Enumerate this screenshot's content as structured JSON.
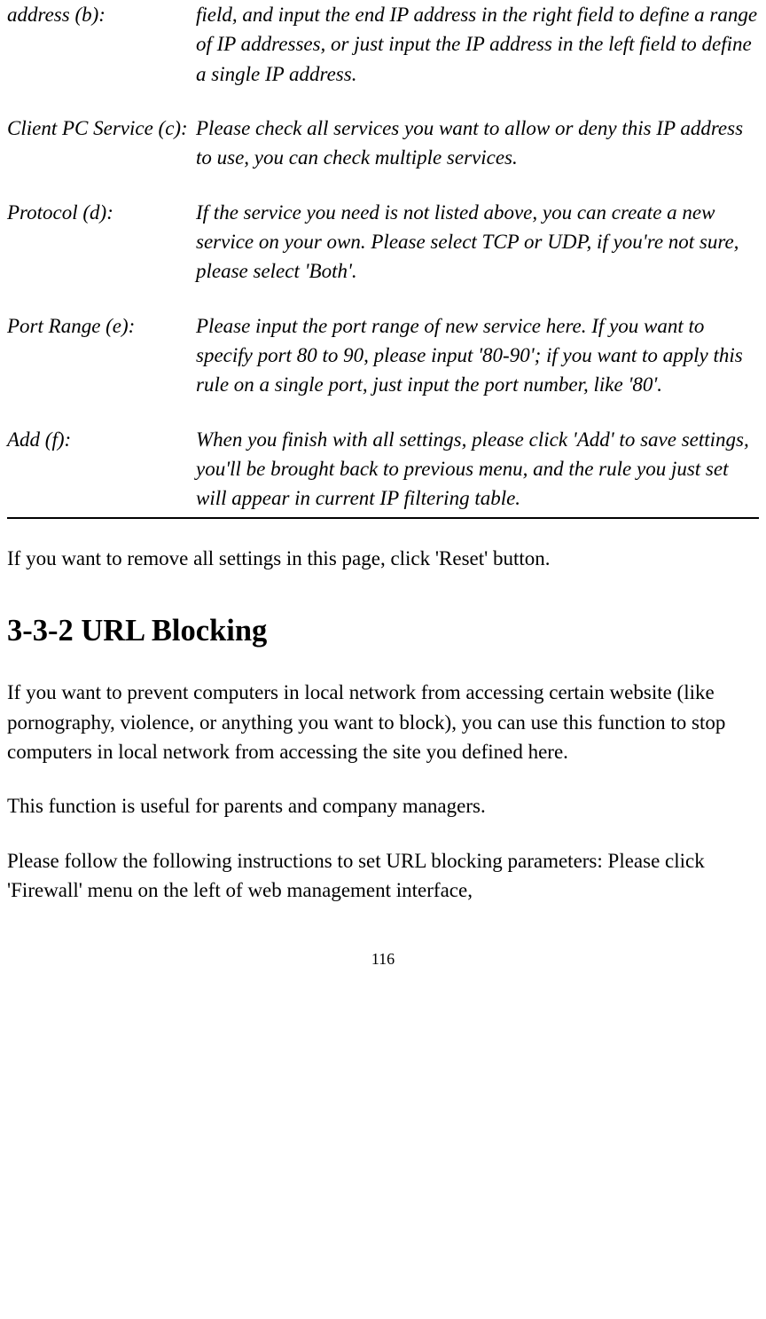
{
  "definitions": [
    {
      "term": "address (b):",
      "desc": "field, and input the end IP address in the right field to define a range of IP addresses, or just input the IP address in the left field to define a single IP address."
    },
    {
      "term": "Client PC Service (c):",
      "desc": "Please check all services you want to allow or deny this IP address to use, you can check multiple services."
    },
    {
      "term": "Protocol (d):",
      "desc": "If the service you need is not listed above, you can create a new service on your own. Please select TCP or UDP, if you're not sure, please select 'Both'."
    },
    {
      "term": "Port Range (e):",
      "desc": "Please input the port range of new service here. If you want to specify port 80 to 90, please input '80-90'; if you want to apply this rule on a single port, just input the port number, like '80'."
    },
    {
      "term": "Add (f):",
      "desc": "When you finish with all settings, please click 'Add' to save settings, you'll be brought back to previous menu, and the rule you just set will appear in current IP filtering table."
    }
  ],
  "para_reset": "If you want to remove all settings in this page, click 'Reset' button.",
  "section_heading": "3-3-2 URL Blocking",
  "para_url_blocking": "If you want to prevent computers in local network from accessing certain website (like pornography, violence, or anything you want to block), you can use this function to stop computers in local network from accessing the site you defined here.",
  "para_useful": "This function is useful for parents and company managers.",
  "para_instructions": "Please follow the following instructions to set URL blocking parameters: Please click 'Firewall' menu on the left of web management interface,",
  "page_number": "116"
}
